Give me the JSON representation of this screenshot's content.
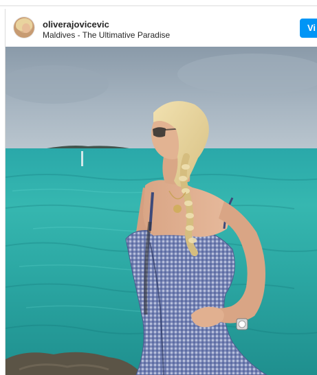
{
  "post": {
    "username": "oliverajovicevic",
    "location": "Maldives - The Ultimative Paradise",
    "view_button": "Vi"
  },
  "icons": {
    "avatar": "profile-avatar"
  }
}
